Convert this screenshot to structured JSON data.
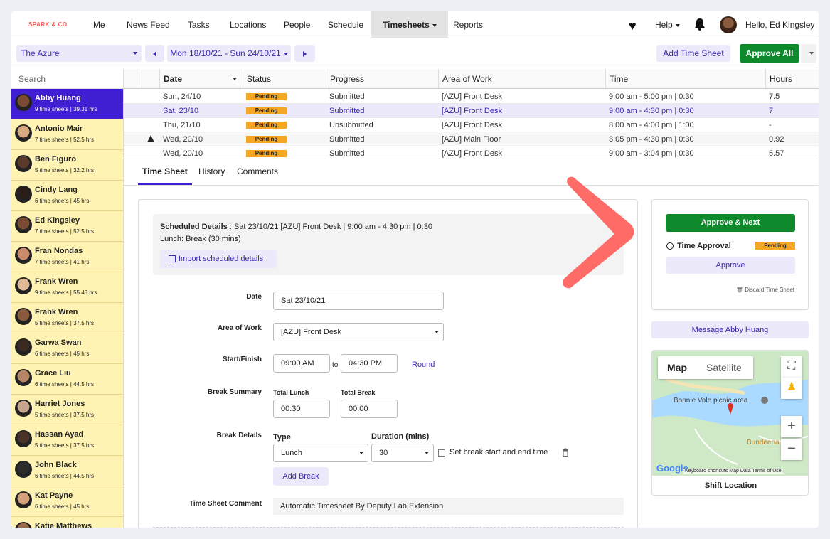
{
  "brand": "SPARK & CO",
  "nav": {
    "items": [
      "Me",
      "News Feed",
      "Tasks",
      "Locations",
      "People",
      "Schedule",
      "Timesheets",
      "Reports"
    ],
    "help": "Help",
    "user": "Hello, Ed Kingsley"
  },
  "toolbar": {
    "location": "The Azure",
    "date_range": "Mon 18/10/21 - Sun 24/10/21",
    "add_timesheet": "Add Time Sheet",
    "approve_all": "Approve All"
  },
  "sidebar": {
    "search_placeholder": "Search",
    "employees": [
      {
        "name": "Abby Huang",
        "summary": "9 time sheets | 39.31 hrs"
      },
      {
        "name": "Antonio Mair",
        "summary": "7 time sheets | 52.5 hrs"
      },
      {
        "name": "Ben Figuro",
        "summary": "5 time sheets | 32.2 hrs"
      },
      {
        "name": "Cindy Lang",
        "summary": "6 time sheets | 45 hrs"
      },
      {
        "name": "Ed Kingsley",
        "summary": "7 time sheets | 52.5 hrs"
      },
      {
        "name": "Fran Nondas",
        "summary": "7 time sheets | 41 hrs"
      },
      {
        "name": "Frank Wren",
        "summary": "9 time sheets | 55.48 hrs"
      },
      {
        "name": "Frank Wren",
        "summary": "5 time sheets | 37.5 hrs"
      },
      {
        "name": "Garwa Swan",
        "summary": "6 time sheets | 45 hrs"
      },
      {
        "name": "Grace Liu",
        "summary": "6 time sheets | 44.5 hrs"
      },
      {
        "name": "Harriet Jones",
        "summary": "5 time sheets | 37.5 hrs"
      },
      {
        "name": "Hassan Ayad",
        "summary": "5 time sheets | 37.5 hrs"
      },
      {
        "name": "John Black",
        "summary": "6 time sheets | 44.5 hrs"
      },
      {
        "name": "Kat Payne",
        "summary": "6 time sheets | 45 hrs"
      },
      {
        "name": "Katie Matthews",
        "summary": ""
      }
    ]
  },
  "table": {
    "headers": [
      "Date",
      "Status",
      "Progress",
      "Area of Work",
      "Time",
      "Hours"
    ],
    "rows": [
      {
        "date": "Sun, 24/10",
        "status": "Pending",
        "progress": "Submitted",
        "area": "[AZU] Front Desk",
        "time": "9:00 am - 5:00 pm | 0:30",
        "hours": "7.5"
      },
      {
        "date": "Sat, 23/10",
        "status": "Pending",
        "progress": "Submitted",
        "area": "[AZU] Front Desk",
        "time": "9:00 am - 4:30 pm | 0:30",
        "hours": "7"
      },
      {
        "date": "Thu, 21/10",
        "status": "Pending",
        "progress": "Unsubmitted",
        "area": "[AZU] Front Desk",
        "time": "8:00 am - 4:00 pm | 1:00",
        "hours": "-"
      },
      {
        "date": "Wed, 20/10",
        "status": "Pending",
        "progress": "Submitted",
        "area": "[AZU] Main Floor",
        "time": "3:05 pm - 4:30 pm | 0:30",
        "hours": "0.92"
      },
      {
        "date": "Wed, 20/10",
        "status": "Pending",
        "progress": "Submitted",
        "area": "[AZU] Front Desk",
        "time": "9:00 am - 3:04 pm | 0:30",
        "hours": "5.57"
      }
    ]
  },
  "tabs": [
    "Time Sheet",
    "History",
    "Comments"
  ],
  "form": {
    "scheduled_label": "Scheduled Details",
    "scheduled_value": " : Sat 23/10/21 [AZU] Front Desk | 9:00 am - 4:30 pm | 0:30",
    "lunch": "Lunch: Break (30 mins)",
    "import_btn": "Import scheduled details",
    "date_label": "Date",
    "date_value": "Sat 23/10/21",
    "area_label": "Area of Work",
    "area_value": "[AZU] Front Desk",
    "startfinish_label": "Start/Finish",
    "start": "09:00 AM",
    "to": "to",
    "finish": "04:30 PM",
    "round": "Round",
    "break_summary_label": "Break Summary",
    "total_lunch_label": "Total Lunch",
    "total_lunch": "00:30",
    "total_break_label": "Total Break",
    "total_break": "00:00",
    "break_details_label": "Break Details",
    "type_label": "Type",
    "type_value": "Lunch",
    "duration_label": "Duration (mins)",
    "duration_value": "30",
    "set_break_label": "Set break start and end time",
    "add_break": "Add Break",
    "comment_label": "Time Sheet Comment",
    "comment_value": "Automatic Timesheet By Deputy Lab Extension"
  },
  "approval": {
    "approve_next": "Approve & Next",
    "time_approval": "Time Approval",
    "status": "Pending",
    "approve": "Approve",
    "discard": "Discard Time Sheet",
    "message": "Message Abby Huang"
  },
  "map": {
    "tab_map": "Map",
    "tab_satellite": "Satellite",
    "place1": "Bonnie Vale picnic area",
    "place2": "Bundeena",
    "google": "Google",
    "attribution": "Keyboard shortcuts   Map Data   Terms of Use",
    "footer": "Shift Location"
  },
  "colors": {
    "accent": "#3f1fd1",
    "pending": "#f5a623",
    "approve_green": "#0e8a2d",
    "highlight_yellow": "#fff3b3",
    "arrow": "#ff6b66"
  }
}
